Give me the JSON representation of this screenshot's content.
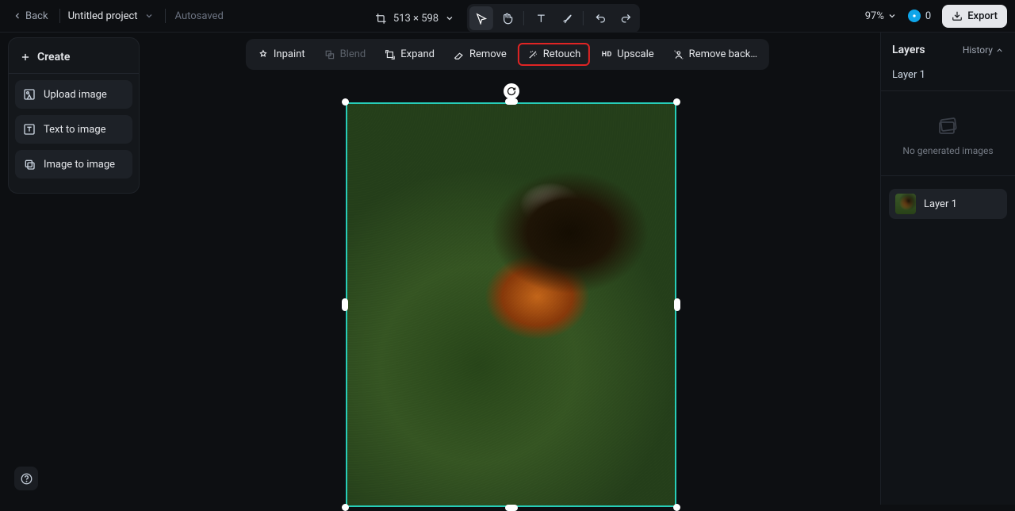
{
  "topbar": {
    "back_label": "Back",
    "project_name": "Untitled project",
    "autosave_label": "Autosaved",
    "dimensions": "513 × 598",
    "zoom": "97%",
    "credits": "0",
    "export_label": "Export"
  },
  "sidebar": {
    "create_label": "Create",
    "items": [
      {
        "label": "Upload image",
        "name": "upload-image"
      },
      {
        "label": "Text to image",
        "name": "text-to-image"
      },
      {
        "label": "Image to image",
        "name": "image-to-image"
      }
    ]
  },
  "context_toolbar": {
    "items": [
      {
        "label": "Inpaint",
        "name": "inpaint",
        "disabled": false,
        "highlight": false
      },
      {
        "label": "Blend",
        "name": "blend",
        "disabled": true,
        "highlight": false
      },
      {
        "label": "Expand",
        "name": "expand",
        "disabled": false,
        "highlight": false
      },
      {
        "label": "Remove",
        "name": "remove",
        "disabled": false,
        "highlight": false
      },
      {
        "label": "Retouch",
        "name": "retouch",
        "disabled": false,
        "highlight": true
      },
      {
        "label": "Upscale",
        "name": "upscale",
        "disabled": false,
        "highlight": false,
        "prefix": "HD"
      },
      {
        "label": "Remove back…",
        "name": "remove-background",
        "disabled": false,
        "highlight": false
      }
    ]
  },
  "right_panel": {
    "title": "Layers",
    "history_label": "History",
    "selected_layer": "Layer 1",
    "no_generated_label": "No generated images",
    "layers": [
      {
        "label": "Layer 1"
      }
    ]
  }
}
